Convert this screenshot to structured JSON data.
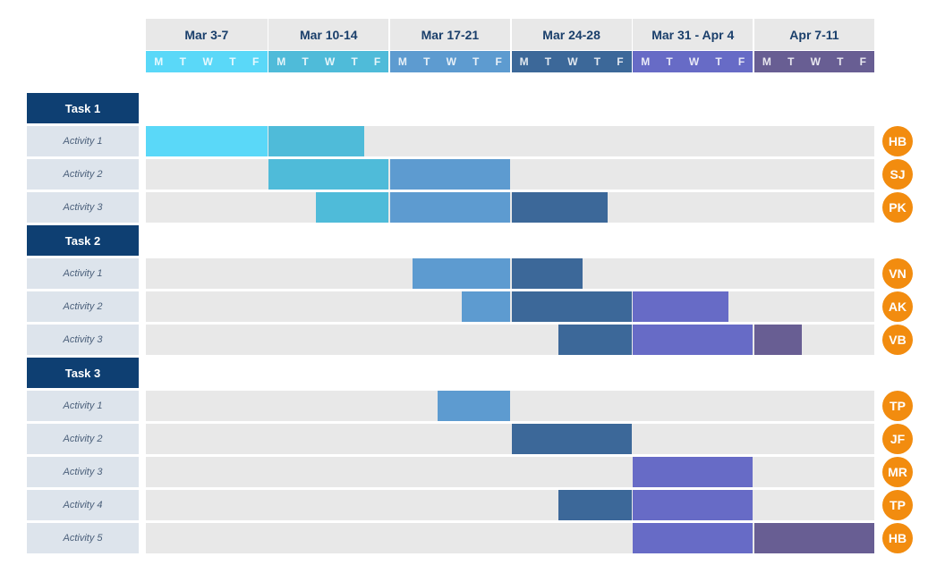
{
  "chart_data": {
    "type": "gantt",
    "title": "",
    "x_unit": "working days from Mar 3 (Mon)",
    "x_range": [
      0,
      30
    ],
    "weeks": [
      {
        "label": "Mar 3-7",
        "color": "#5ad8f8"
      },
      {
        "label": "Mar 10-14",
        "color": "#4fbbd9"
      },
      {
        "label": "Mar 17-21",
        "color": "#5d9bd0"
      },
      {
        "label": "Mar 24-28",
        "color": "#3c6899"
      },
      {
        "label": "Mar 31 - Apr 4",
        "color": "#676bc6"
      },
      {
        "label": "Apr 7-11",
        "color": "#685e93"
      }
    ],
    "day_labels": [
      "M",
      "T",
      "W",
      "T",
      "F"
    ],
    "tasks": [
      {
        "label": "Task 1",
        "activities": [
          {
            "label": "Activity 1",
            "owner": "HB",
            "start": 0,
            "end": 9
          },
          {
            "label": "Activity 2",
            "owner": "SJ",
            "start": 5,
            "end": 15
          },
          {
            "label": "Activity 3",
            "owner": "PK",
            "start": 7,
            "end": 19
          }
        ]
      },
      {
        "label": "Task 2",
        "activities": [
          {
            "label": "Activity 1",
            "owner": "VN",
            "start": 11,
            "end": 18
          },
          {
            "label": "Activity 2",
            "owner": "AK",
            "start": 13,
            "end": 24
          },
          {
            "label": "Activity 3",
            "owner": "VB",
            "start": 17,
            "end": 27
          }
        ]
      },
      {
        "label": "Task 3",
        "activities": [
          {
            "label": "Activity 1",
            "owner": "TP",
            "start": 12,
            "end": 15
          },
          {
            "label": "Activity 2",
            "owner": "JF",
            "start": 15,
            "end": 20
          },
          {
            "label": "Activity 3",
            "owner": "MR",
            "start": 20,
            "end": 25
          },
          {
            "label": "Activity 4",
            "owner": "TP",
            "start": 17,
            "end": 25
          },
          {
            "label": "Activity 5",
            "owner": "HB",
            "start": 20,
            "end": 30
          }
        ]
      }
    ]
  },
  "colors": {
    "task_header": "#0e3f72",
    "activity_label_bg": "#dde4ec",
    "track_bg": "#e8e8e8",
    "avatar": "#f28c0f",
    "week_header_text": "#1a3f6b"
  }
}
